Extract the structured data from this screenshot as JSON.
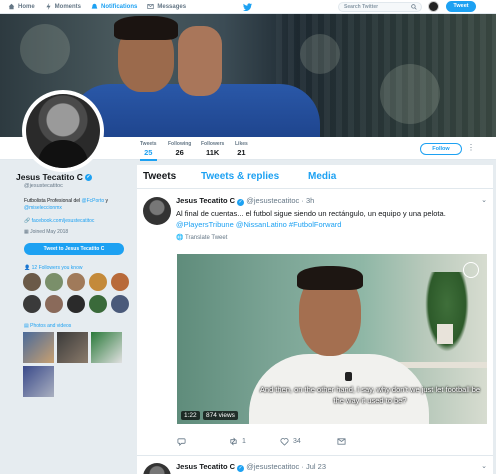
{
  "nav": {
    "items": [
      {
        "label": "Home",
        "icon": "home-icon"
      },
      {
        "label": "Moments",
        "icon": "lightning-icon"
      },
      {
        "label": "Notifications",
        "icon": "bell-icon"
      },
      {
        "label": "Messages",
        "icon": "envelope-icon"
      }
    ],
    "search_placeholder": "Search Twitter",
    "tweet_button": "Tweet"
  },
  "stats": [
    {
      "label": "Tweets",
      "value": "25"
    },
    {
      "label": "Following",
      "value": "26"
    },
    {
      "label": "Followers",
      "value": "11K"
    },
    {
      "label": "Likes",
      "value": "21"
    }
  ],
  "profile": {
    "name": "Jesus Tecatito C",
    "handle": "@jesustecatitoc",
    "bio_prefix": "Futbolista Profesional del ",
    "bio_link1": "@FcPorto",
    "bio_mid": " y ",
    "bio_link2": "@miseleccionmx",
    "website": "facebook.com/jesustecatitoc",
    "joined": "Joined May 2018",
    "tweet_to_button": "Tweet to Jesus Tecatito C",
    "followers_you_know": "12 Followers you know",
    "photos_and_videos": "Photos and videos",
    "follow_button": "Follow"
  },
  "tabs": [
    "Tweets",
    "Tweets & replies",
    "Media"
  ],
  "tweets": [
    {
      "name": "Jesus Tecatito C",
      "handle": "@jesustecatitoc",
      "date": "3h",
      "text": "Al final de cuentas... el futbol sigue siendo un rectángulo, un equipo y una pelota.",
      "links": "@PlayersTribune @NissanLatino #FutbolForward",
      "translate": "Translate Tweet",
      "video": {
        "subtitle": "And then, on the other hand, I say, why don't we just let football be the way it used to be?",
        "duration": "1:22",
        "views": "874 views"
      },
      "retweets": "1",
      "likes": "34"
    },
    {
      "name": "Jesus Tecatito C",
      "handle": "@jesustecatitoc",
      "date": "Jul 23"
    }
  ],
  "colors": {
    "accent": "#1da1f2",
    "text": "#14171a",
    "muted": "#657786"
  }
}
